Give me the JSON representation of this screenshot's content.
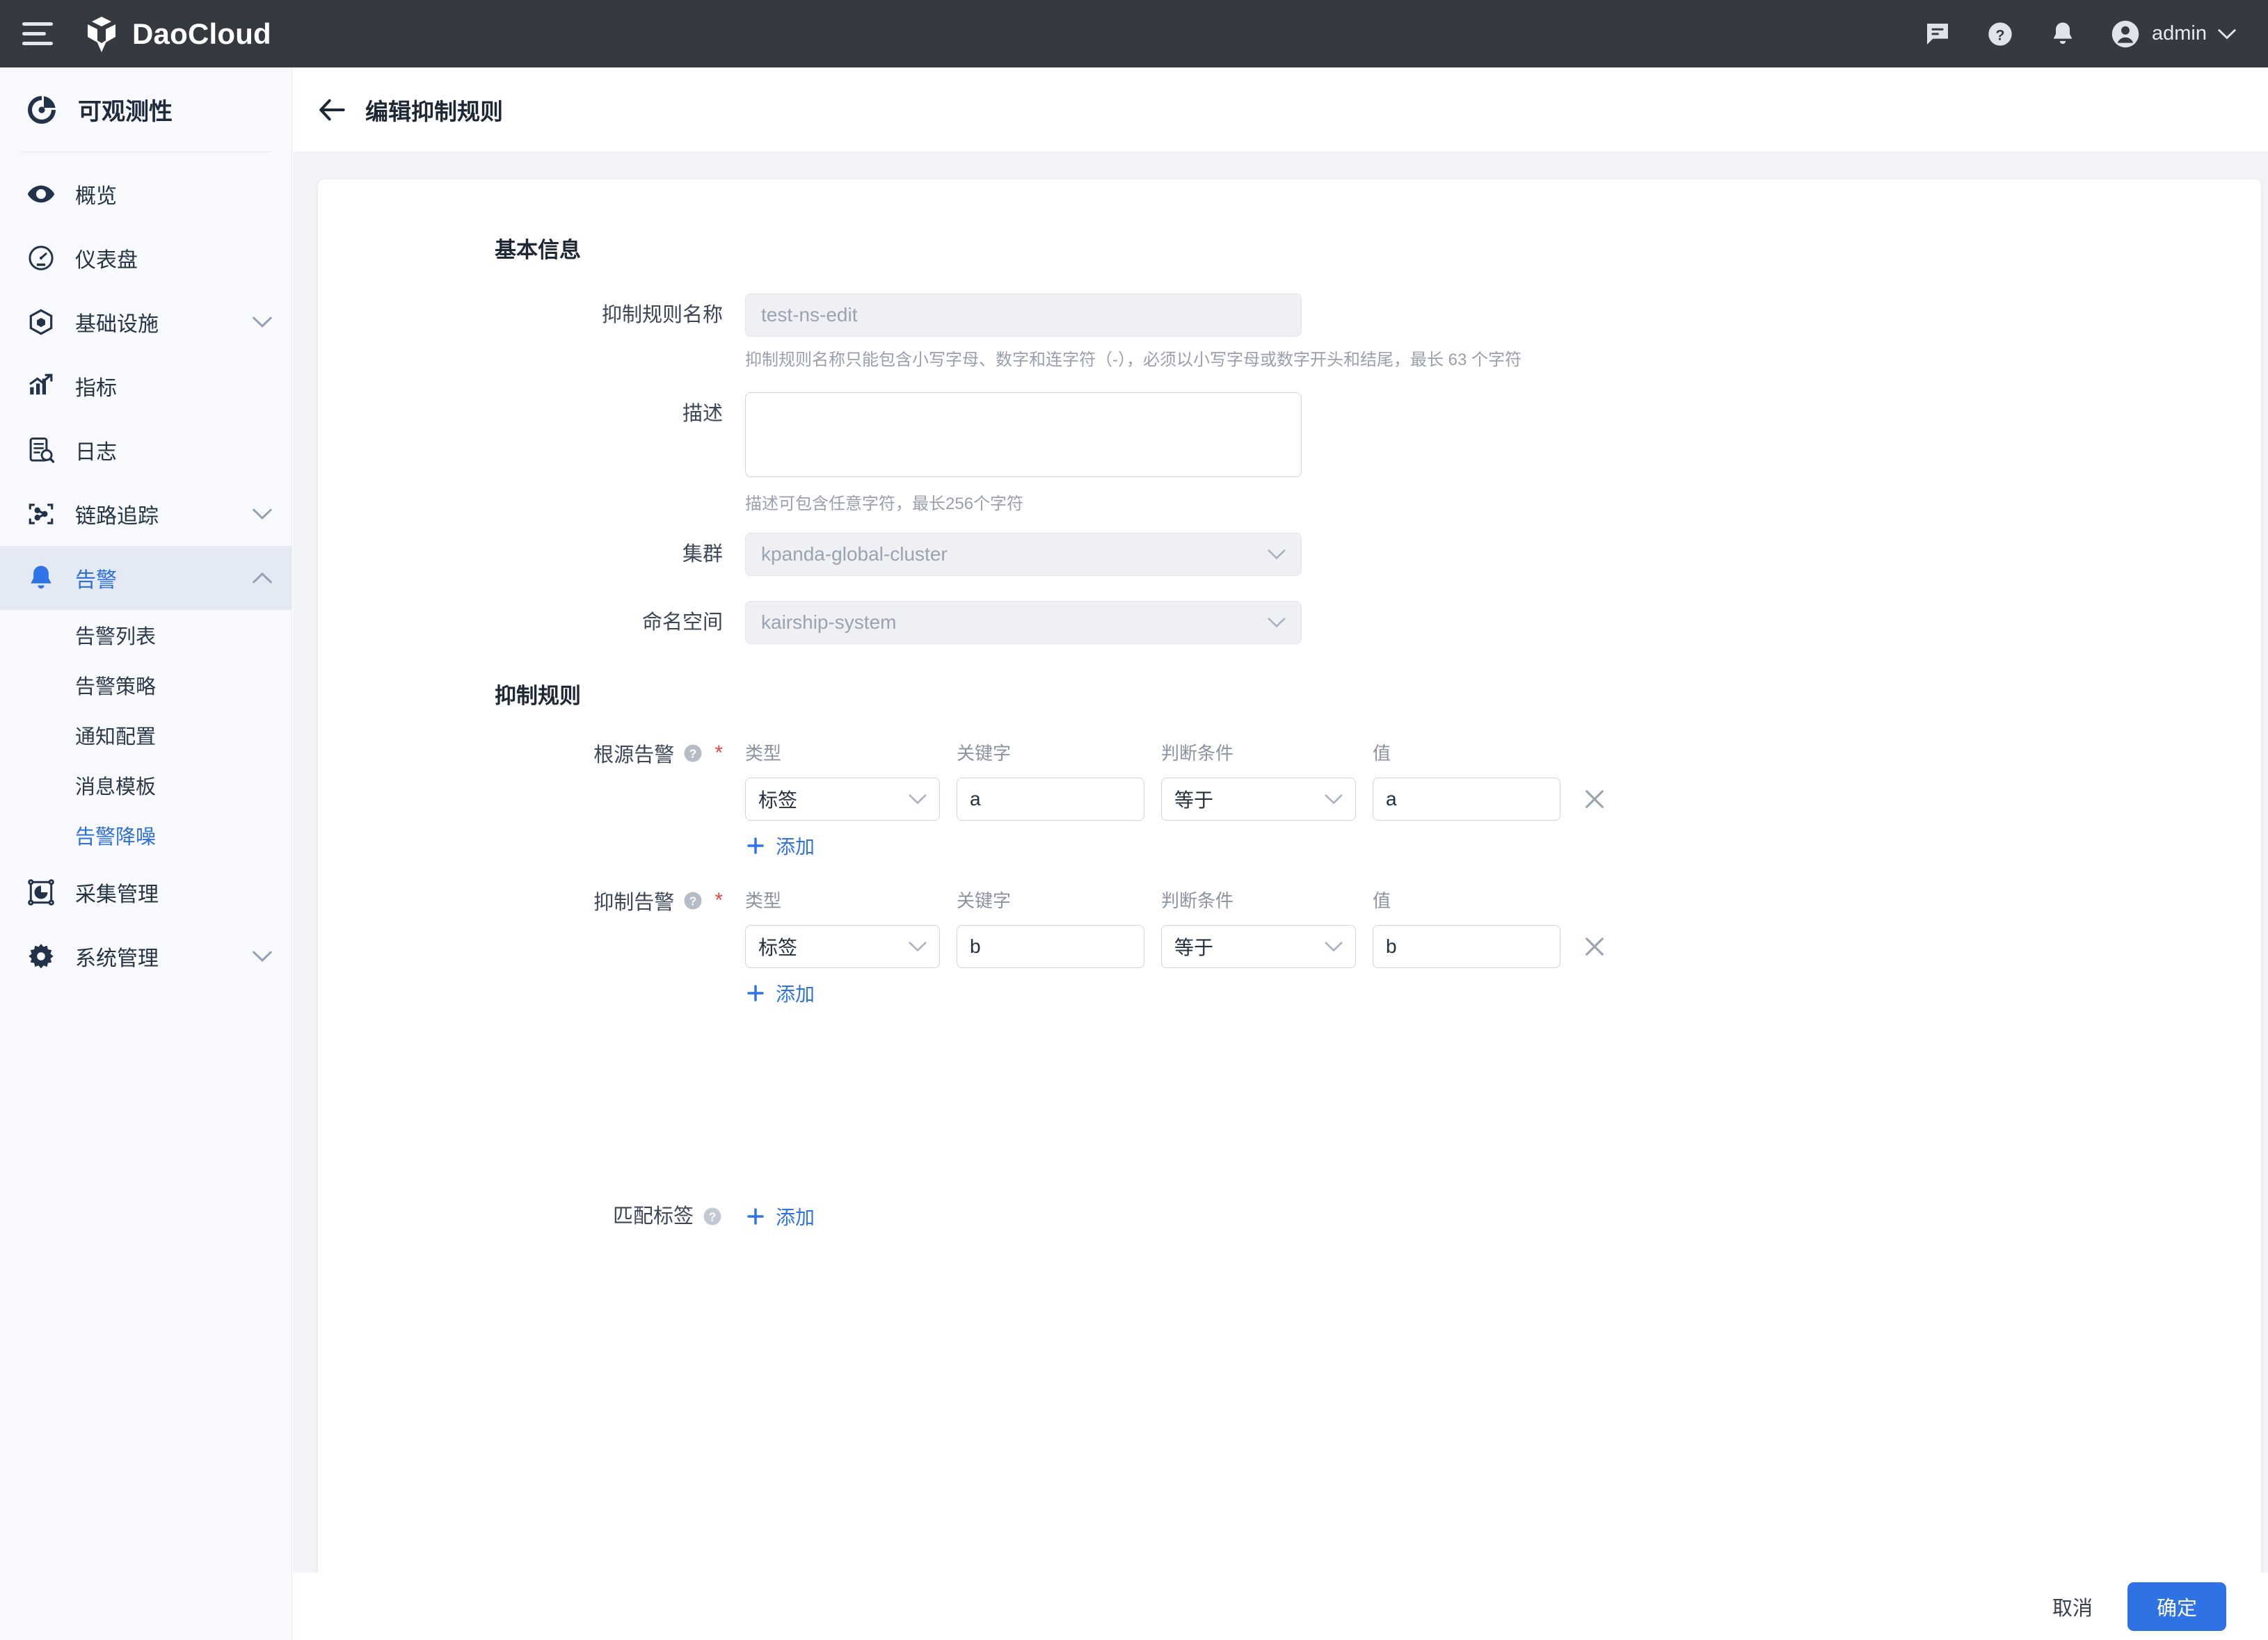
{
  "header": {
    "brand": "DaoCloud",
    "menu_icon": "hamburger-icon",
    "message_icon": "message-icon",
    "help_icon": "help-circle-icon",
    "bell_icon": "bell-icon",
    "avatar_icon": "user-avatar-icon",
    "user": "admin"
  },
  "sidebar": {
    "product": "可观测性",
    "items": [
      {
        "label": "概览",
        "icon": "eye-icon",
        "expandable": false,
        "active": false
      },
      {
        "label": "仪表盘",
        "icon": "gauge-icon",
        "expandable": false,
        "active": false
      },
      {
        "label": "基础设施",
        "icon": "cube-icon",
        "expandable": true,
        "expanded": false,
        "active": false
      },
      {
        "label": "指标",
        "icon": "chart-line-icon",
        "expandable": false,
        "active": false
      },
      {
        "label": "日志",
        "icon": "log-search-icon",
        "expandable": false,
        "active": false
      },
      {
        "label": "链路追踪",
        "icon": "trace-icon",
        "expandable": true,
        "expanded": false,
        "active": false
      },
      {
        "label": "告警",
        "icon": "bell-icon",
        "expandable": true,
        "expanded": true,
        "active": true
      },
      {
        "label": "采集管理",
        "icon": "collect-icon",
        "expandable": false,
        "active": false
      },
      {
        "label": "系统管理",
        "icon": "gear-icon",
        "expandable": true,
        "expanded": false,
        "active": false
      }
    ],
    "alert_subitems": [
      {
        "label": "告警列表",
        "active": false
      },
      {
        "label": "告警策略",
        "active": false
      },
      {
        "label": "通知配置",
        "active": false
      },
      {
        "label": "消息模板",
        "active": false
      },
      {
        "label": "告警降噪",
        "active": true
      }
    ]
  },
  "page": {
    "back_icon": "arrow-left-icon",
    "title": "编辑抑制规则"
  },
  "basic": {
    "section_title": "基本信息",
    "name": {
      "label": "抑制规则名称",
      "value": "",
      "placeholder": "test-ns-edit",
      "disabled": true,
      "helper": "抑制规则名称只能包含小写字母、数字和连字符（-），必须以小写字母或数字开头和结尾，最长 63 个字符"
    },
    "description": {
      "label": "描述",
      "value": "",
      "placeholder": "",
      "helper": "描述可包含任意字符，最长256个字符"
    },
    "cluster": {
      "label": "集群",
      "value": "kpanda-global-cluster",
      "disabled": true,
      "chevron_icon": "chevron-down-icon"
    },
    "namespace": {
      "label": "命名空间",
      "value": "kairship-system",
      "disabled": true,
      "chevron_icon": "chevron-down-icon"
    }
  },
  "rules": {
    "section_title": "抑制规则",
    "column_headers": {
      "type": "类型",
      "keyword": "关键字",
      "condition": "判断条件",
      "value": "值"
    },
    "add_label": "添加",
    "add_icon": "plus-icon",
    "delete_icon": "close-x-icon",
    "help_icon": "question-circle-icon",
    "groups": [
      {
        "label": "根源告警",
        "required": true,
        "rows": [
          {
            "type": "标签",
            "keyword": "a",
            "condition": "等于",
            "value": "a"
          }
        ]
      },
      {
        "label": "抑制告警",
        "required": true,
        "rows": [
          {
            "type": "标签",
            "keyword": "b",
            "condition": "等于",
            "value": "b"
          }
        ]
      }
    ],
    "match_labels": {
      "label": "匹配标签",
      "required": false,
      "add_label": "添加"
    }
  },
  "footer": {
    "cancel": "取消",
    "confirm": "确定"
  },
  "colors": {
    "accent": "#2f72e3",
    "topbar": "#343a40",
    "sidebar_bg": "#f7f9fc",
    "page_bg": "#f1f3f7",
    "required_star": "#e5484d"
  }
}
